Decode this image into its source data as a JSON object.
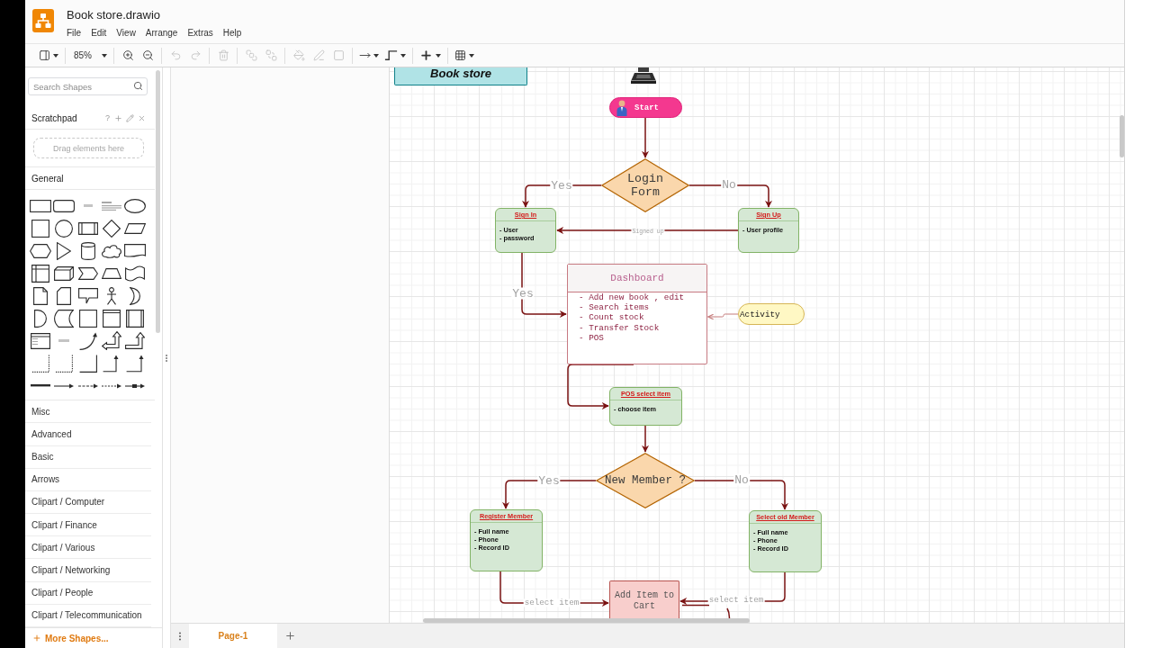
{
  "app": {
    "title": "Book store.drawio",
    "menu": [
      {
        "label": "File"
      },
      {
        "label": "Edit"
      },
      {
        "label": "View"
      },
      {
        "label": "Arrange"
      },
      {
        "label": "Extras"
      },
      {
        "label": "Help"
      }
    ]
  },
  "toolbar": {
    "groups": [
      {
        "tools": [
          {
            "kind": "format-panel",
            "disabled": false
          }
        ]
      },
      {
        "tools": [
          {
            "kind": "zoom-level",
            "label": "85%",
            "disabled": false
          }
        ]
      },
      {
        "tools": [
          {
            "kind": "zoom-in",
            "disabled": false
          },
          {
            "kind": "zoom-out",
            "disabled": false
          }
        ]
      },
      {
        "tools": [
          {
            "kind": "undo",
            "disabled": true
          },
          {
            "kind": "redo",
            "disabled": true
          }
        ]
      },
      {
        "tools": [
          {
            "kind": "delete",
            "disabled": true
          }
        ]
      },
      {
        "tools": [
          {
            "kind": "to-front",
            "disabled": true
          },
          {
            "kind": "to-back",
            "disabled": true
          }
        ]
      },
      {
        "tools": [
          {
            "kind": "fill-color",
            "disabled": true
          },
          {
            "kind": "line-color",
            "disabled": true
          },
          {
            "kind": "shadow",
            "disabled": true
          }
        ]
      },
      {
        "tools": [
          {
            "kind": "connection",
            "disabled": false
          },
          {
            "kind": "waypoints",
            "disabled": false
          }
        ]
      },
      {
        "tools": [
          {
            "kind": "insert",
            "disabled": false
          }
        ]
      },
      {
        "tools": [
          {
            "kind": "table",
            "disabled": false
          }
        ]
      }
    ]
  },
  "sidebar": {
    "search": {
      "placeholder": "Search Shapes"
    },
    "scratchpad": {
      "title": "Scratchpad",
      "help": "?",
      "drop_hint": "Drag elements here"
    },
    "general": {
      "title": "General"
    },
    "categories": [
      "Misc",
      "Advanced",
      "Basic",
      "Arrows",
      "Clipart / Computer",
      "Clipart / Finance",
      "Clipart / Various",
      "Clipart / Networking",
      "Clipart / People",
      "Clipart / Telecommunication"
    ],
    "more_shapes": "More Shapes..."
  },
  "diagram": {
    "nodes": [
      {
        "kind": "banner",
        "text": "Book store"
      },
      {
        "kind": "terminator",
        "text": "Start"
      },
      {
        "kind": "decision",
        "text": "Login Form"
      },
      {
        "kind": "card",
        "title": "Sign In",
        "items": [
          "- User",
          "- password"
        ]
      },
      {
        "kind": "card",
        "title": "Sign Up",
        "items": [
          "- User profile"
        ]
      },
      {
        "kind": "panel",
        "title": "Dashboard",
        "items": [
          "- Add new book , edit",
          "- Search items",
          "- Count stock",
          "- Transfer Stock",
          "- POS"
        ]
      },
      {
        "kind": "pill",
        "text": "Activity"
      },
      {
        "kind": "card",
        "title": "POS select item",
        "items": [
          "- choose item"
        ]
      },
      {
        "kind": "decision",
        "text": "New Member ?"
      },
      {
        "kind": "card",
        "title": "Register Member",
        "items": [
          "- Full name",
          "- Phone",
          "- Record ID"
        ]
      },
      {
        "kind": "card",
        "title": "Select old Member",
        "items": [
          "- Full name",
          "- Phone",
          "- Record ID"
        ]
      },
      {
        "kind": "action",
        "text": "Add Item to Cart"
      }
    ],
    "edge_labels": [
      "Yes",
      "No",
      "Signed up",
      "Yes",
      "Yes",
      "No",
      "select item",
      "select item"
    ]
  },
  "pages": [
    {
      "label": "Page-1",
      "selected": true
    }
  ]
}
